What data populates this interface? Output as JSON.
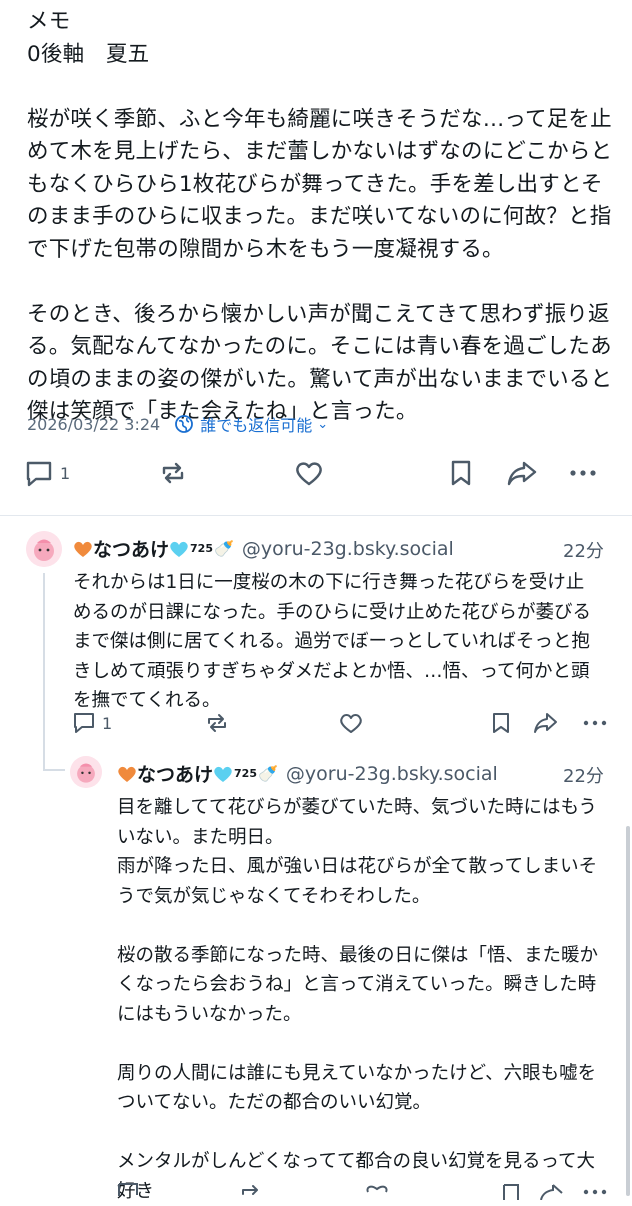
{
  "post": {
    "body": "メモ\n0後軸　夏五\n\n桜が咲く季節、ふと今年も綺麗に咲きそうだな…って足を止めて木を見上げたら、まだ蕾しかないはずなのにどこからともなくひらひら1枚花びらが舞ってきた。手を差し出すとそのまま手のひらに収まった。まだ咲いてないのに何故？と指で下げた包帯の隙間から木をもう一度凝視する。\n\nそのとき、後ろから懐かしい声が聞こえてきて思わず振り返る。気配なんてなかったのに。そこには青い春を過ごしたあの頃のままの姿の傑がいた。驚いて声が出ないままでいると傑は笑顔で「また会えたね」と言った。",
    "timestamp": "2026/03/22 3:24",
    "reply_setting": "誰でも返信可能",
    "reply_count": "1"
  },
  "replies": [
    {
      "name": "なつあけ",
      "name_suffix": "725",
      "handle": "@yoru-23g.bsky.social",
      "time": "22分",
      "text": "それからは1日に一度桜の木の下に行き舞った花びらを受け止めるのが日課になった。手のひらに受け止めた花びらが萎びるまで傑は側に居てくれる。過労でぼーっとしていればそっと抱きしめて頑張りすぎちゃダメだよとか悟、…悟、って何かと頭を撫でてくれる。",
      "reply_count": "1"
    },
    {
      "name": "なつあけ",
      "name_suffix": "725",
      "handle": "@yoru-23g.bsky.social",
      "time": "22分",
      "text": "目を離してて花びらが萎びていた時、気づいた時にはもういない。また明日。\n雨が降った日、風が強い日は花びらが全て散ってしまいそうで気が気じゃなくてそわそわした。\n\n桜の散る季節になった時、最後の日に傑は「悟、また暖かくなったら会おうね」と言って消えていった。瞬きした時にはもういなかった。\n\n周りの人間には誰にも見えていなかったけど、六眼も嘘をついてない。ただの都合のいい幻覚。\n\nメンタルがしんどくなってて都合の良い幻覚を見るって大好き"
    }
  ],
  "colors": {
    "accent": "#1a6fd1",
    "heart_orange": "#f08a3c",
    "heart_cyan": "#5bd0f0"
  }
}
